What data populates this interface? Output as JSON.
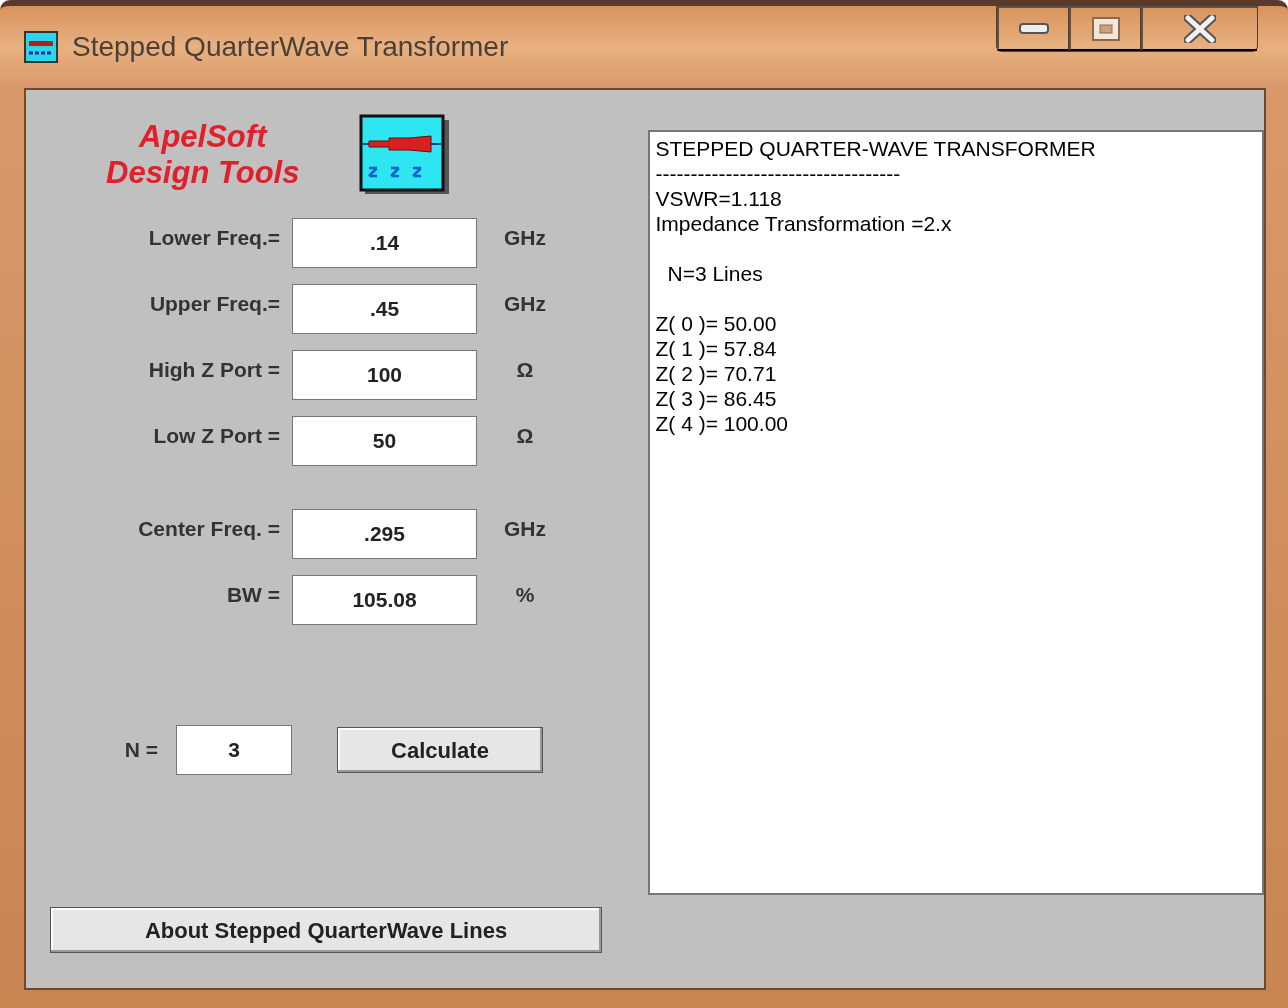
{
  "window": {
    "title": "Stepped QuarterWave Transformer"
  },
  "brand": {
    "line_1": "ApelSoft",
    "line_2": "Design Tools"
  },
  "groups": [
    [
      {
        "label": "Lower Freq.=",
        "value": ".14",
        "unit": "GHz"
      },
      {
        "label": "Upper Freq.=",
        "value": ".45",
        "unit": "GHz"
      },
      {
        "label": "High Z Port =",
        "value": "100",
        "unit": "Ω"
      },
      {
        "label": "Low Z Port =",
        "value": "50",
        "unit": "Ω"
      }
    ],
    [
      {
        "label": "Center Freq. =",
        "value": ".295",
        "unit": "GHz"
      },
      {
        "label": "BW =",
        "value": "105.08",
        "unit": "%"
      }
    ]
  ],
  "n_field": {
    "label": "N =",
    "value": "3"
  },
  "calculate_button": "Calculate",
  "about_button": "About Stepped QuarterWave Lines",
  "output": [
    [
      "STEPPED QUARTER-WAVE TRANSFORMER",
      "-----------------------------------",
      "VSWR=1.118",
      "Impedance Transformation =2.x"
    ],
    [
      "N=3 Lines"
    ],
    [
      "Z( 0 )= 50.00",
      "Z( 1 )= 57.84",
      "Z( 2 )= 70.71",
      "Z( 3 )= 86.45",
      "Z( 4 )= 100.00"
    ]
  ]
}
